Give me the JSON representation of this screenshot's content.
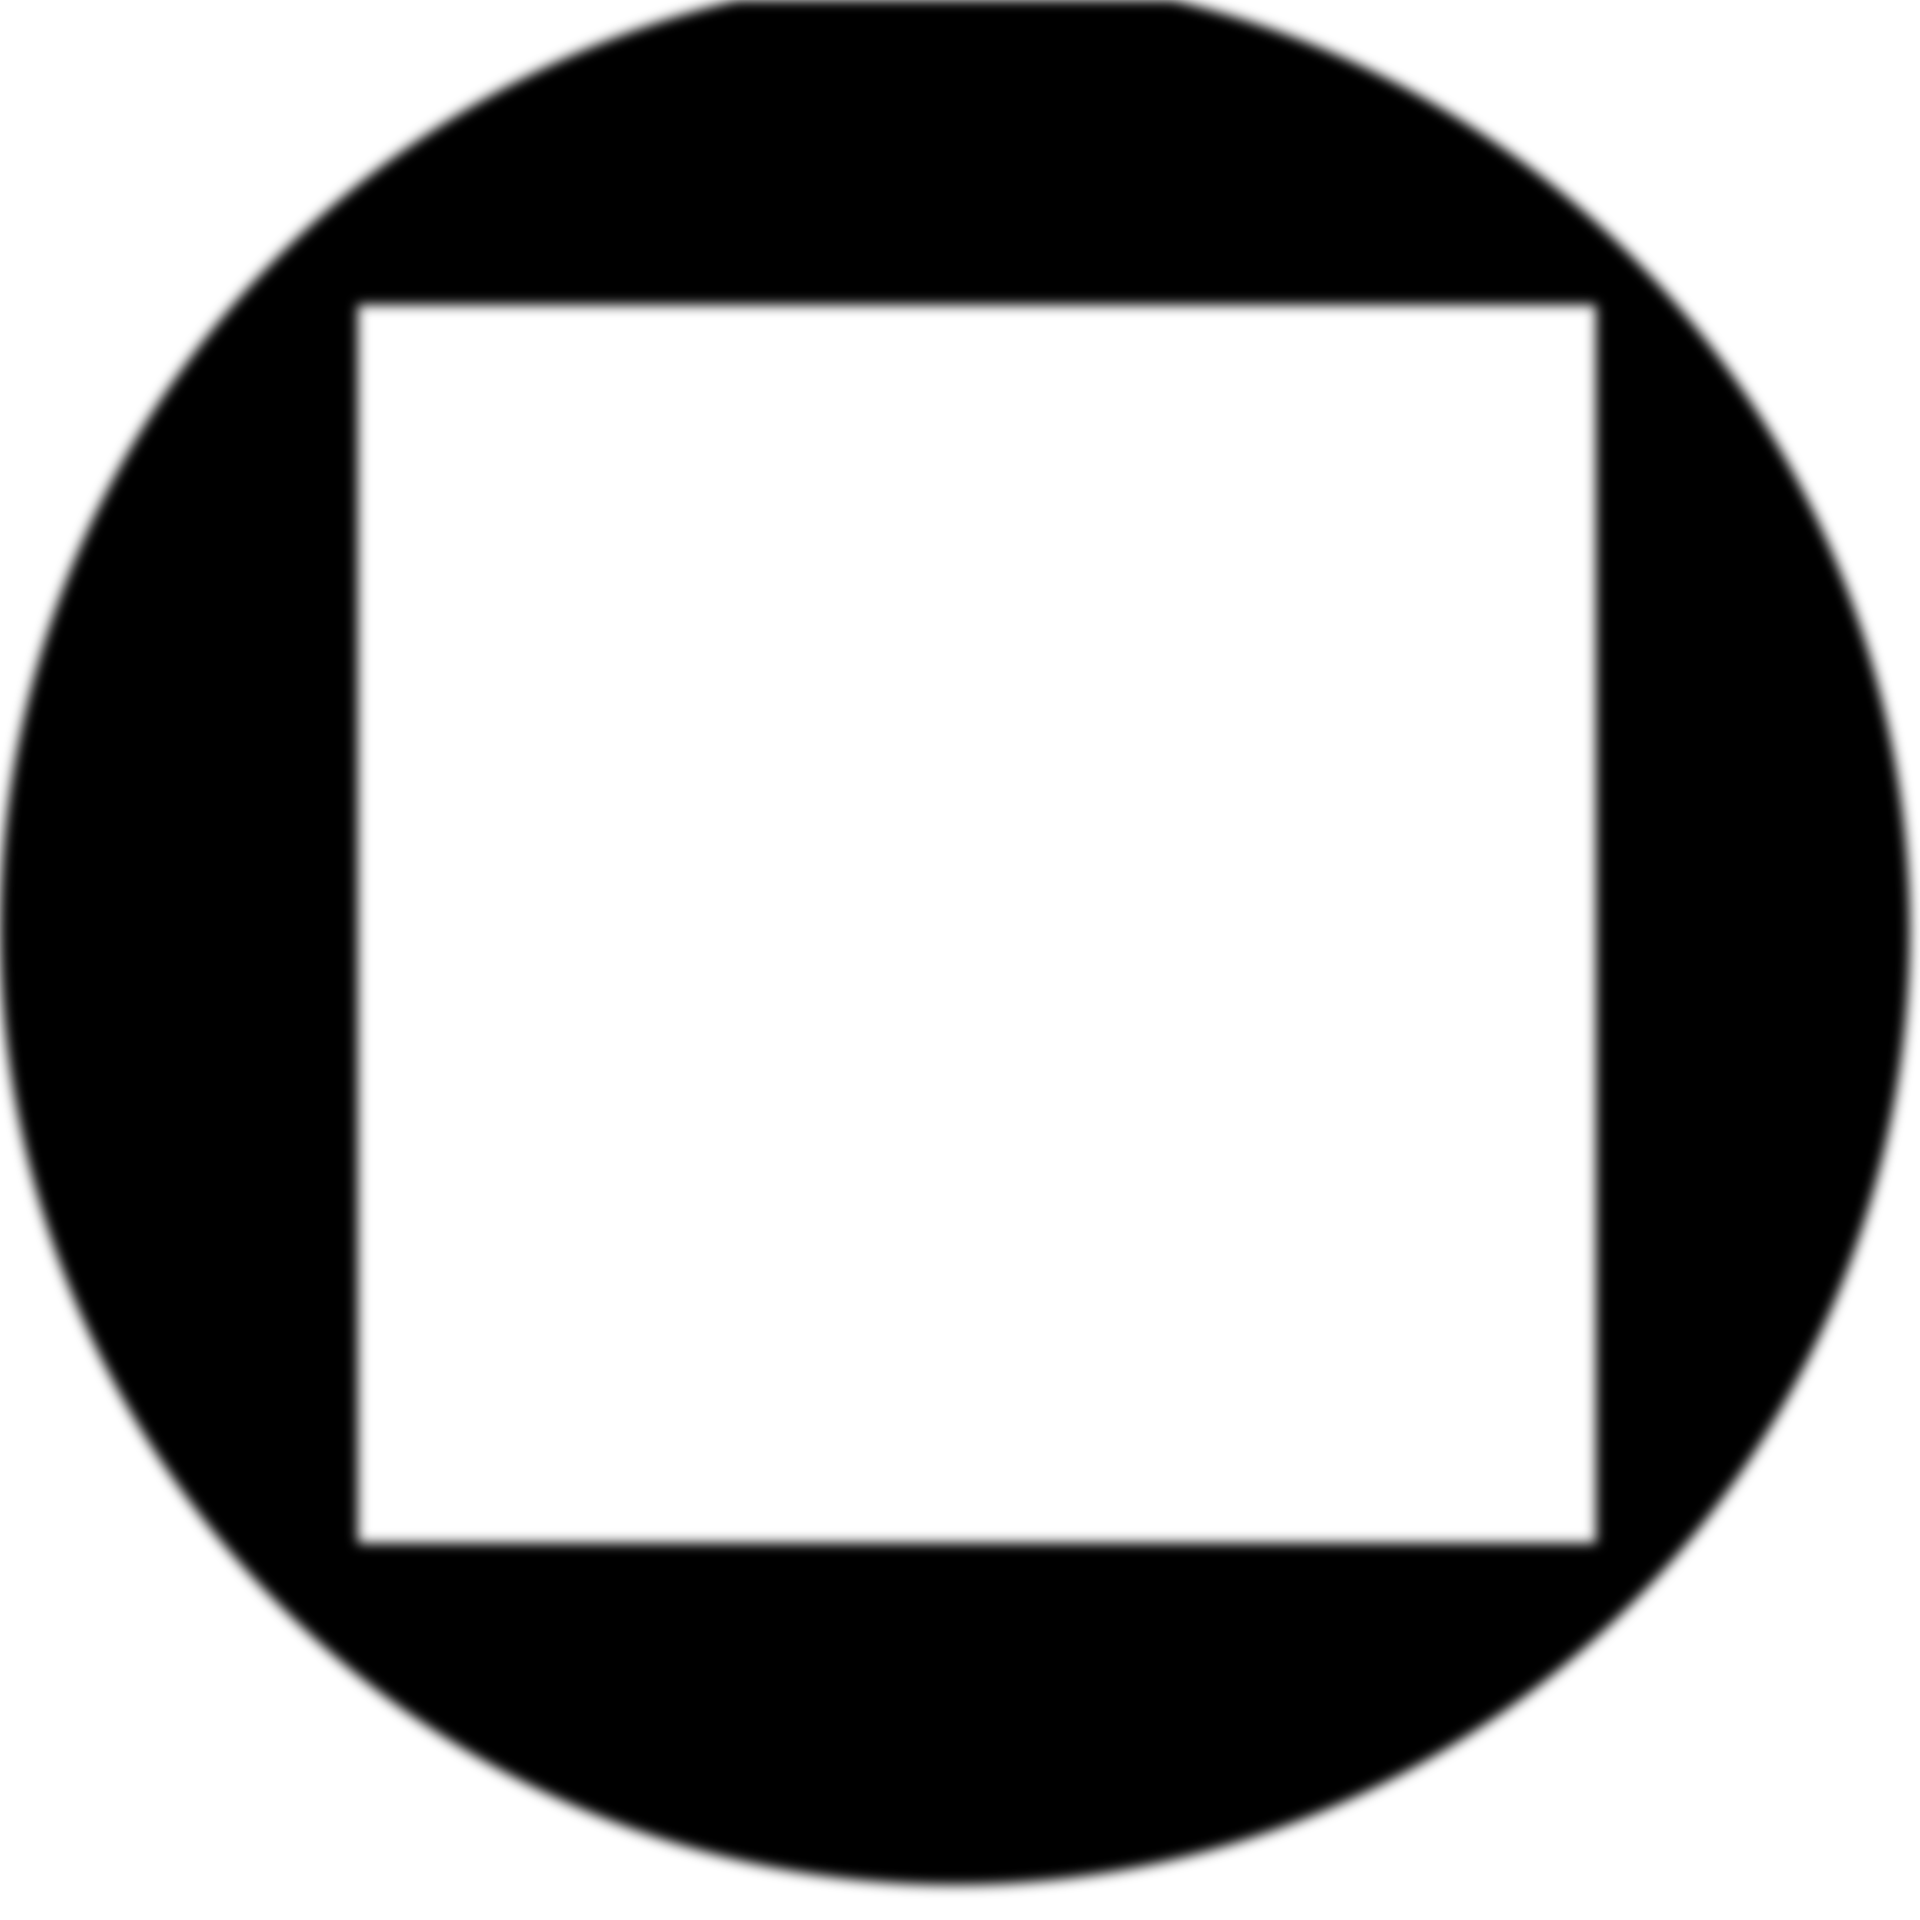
{
  "icon": {
    "name": "stop-icon",
    "background_color": "#ffffff",
    "ring_color": "#000000",
    "square_color": "#ffffff"
  }
}
